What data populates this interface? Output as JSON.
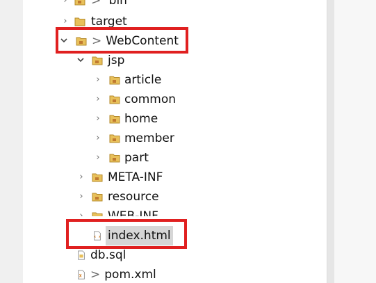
{
  "tree": {
    "items": [
      {
        "label": "bin",
        "dirty": "> ",
        "toggle": "›",
        "icon": "folder-project-icon"
      },
      {
        "label": "target",
        "dirty": "",
        "toggle": "›",
        "icon": "folder-icon"
      },
      {
        "label": "WebContent",
        "dirty": ">",
        "toggle": "⌄",
        "icon": "folder-project-icon"
      },
      {
        "label": "jsp",
        "dirty": "",
        "toggle": "⌄",
        "icon": "folder-project-icon"
      },
      {
        "label": "article",
        "dirty": "",
        "toggle": "›",
        "icon": "folder-project-icon"
      },
      {
        "label": "common",
        "dirty": "",
        "toggle": "›",
        "icon": "folder-project-icon"
      },
      {
        "label": "home",
        "dirty": "",
        "toggle": "›",
        "icon": "folder-project-icon"
      },
      {
        "label": "member",
        "dirty": "",
        "toggle": "›",
        "icon": "folder-project-icon"
      },
      {
        "label": "part",
        "dirty": "",
        "toggle": "›",
        "icon": "folder-project-icon"
      },
      {
        "label": "META-INF",
        "dirty": "",
        "toggle": "›",
        "icon": "folder-project-icon"
      },
      {
        "label": "resource",
        "dirty": "",
        "toggle": "›",
        "icon": "folder-project-icon"
      },
      {
        "label": "WEB-INF",
        "dirty": "",
        "toggle": "›",
        "icon": "folder-project-icon"
      },
      {
        "label": "index.html",
        "dirty": "",
        "toggle": "",
        "icon": "html-file-icon"
      },
      {
        "label": "db.sql",
        "dirty": "",
        "toggle": "",
        "icon": "file-icon"
      },
      {
        "label": "pom.xml",
        "dirty": ">",
        "toggle": "",
        "icon": "xml-file-icon"
      }
    ]
  },
  "colors": {
    "highlight": "#e02020",
    "selection": "#d6d6d6",
    "folder": "#e8c05a"
  }
}
